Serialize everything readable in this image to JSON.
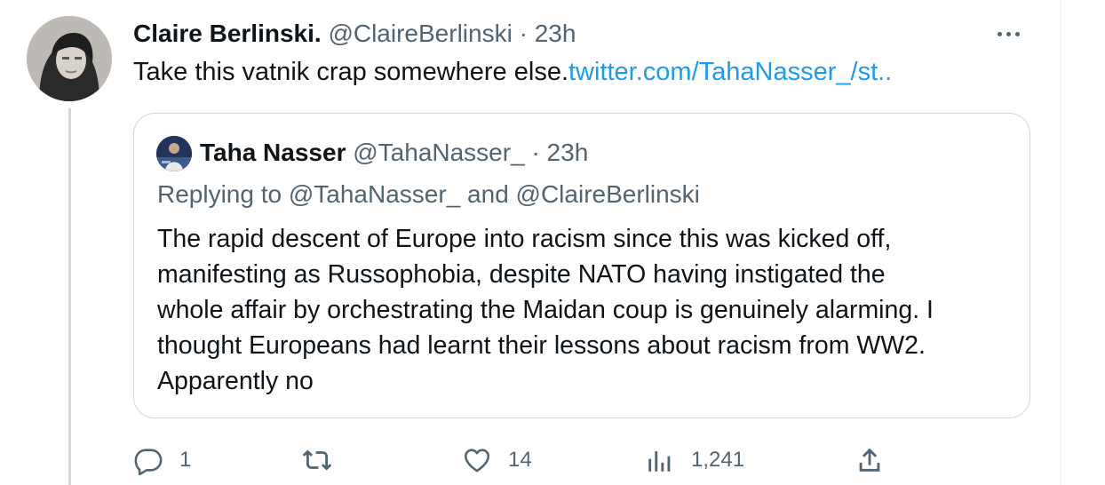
{
  "tweet": {
    "author_name": "Claire Berlinski.",
    "handle": "@ClaireBerlinski",
    "separator": "·",
    "time": "23h",
    "text": "Take this vatnik crap somewhere else.",
    "link_text": "twitter.com/TahaNasser_/st.."
  },
  "quote": {
    "author_name": "Taha Nasser",
    "handle": "@TahaNasser_",
    "separator": "·",
    "time": "23h",
    "replying_to": "Replying to @TahaNasser_ and @ClaireBerlinski",
    "lines": [
      "The rapid descent of Europe into racism since this was kicked off,",
      "manifesting as Russophobia, despite NATO having instigated the",
      "whole affair by orchestrating the Maidan coup is genuinely alarming. I",
      "thought Europeans had learnt their lessons about racism from WW2.",
      "Apparently no"
    ]
  },
  "actions": {
    "reply_count": "1",
    "retweet_count": "",
    "like_count": "14",
    "view_count": "1,241"
  },
  "colors": {
    "link": "#1d9bf0",
    "muted": "#536471",
    "border": "#cfd9de",
    "text": "#0f1419"
  },
  "icons": [
    "more-icon",
    "reply-icon",
    "retweet-icon",
    "like-icon",
    "views-icon",
    "share-icon"
  ]
}
